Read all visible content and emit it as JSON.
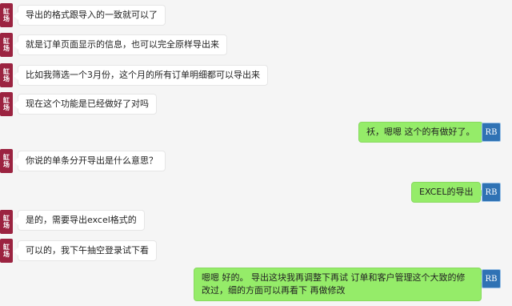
{
  "left_avatar_text": "缸\n场",
  "right_avatar_text": "RB",
  "messages": [
    {
      "side": "left",
      "text": "导出的格式跟导入的一致就可以了"
    },
    {
      "side": "left",
      "text": "就是订单页面显示的信息，也可以完全原样导出来"
    },
    {
      "side": "left",
      "text": "比如我筛选一个3月份，这个月的所有订单明细都可以导出来"
    },
    {
      "side": "left",
      "text": "现在这个功能是已经做好了对吗"
    },
    {
      "side": "right",
      "text": "袄，嗯嗯 这个的有做好了。"
    },
    {
      "side": "left",
      "text": "你说的单条分开导出是什么意思？"
    },
    {
      "side": "right",
      "text": "EXCEL的导出"
    },
    {
      "side": "left",
      "text": "是的，需要导出excel格式的"
    },
    {
      "side": "left",
      "text": "可以的，我下午抽空登录试下看"
    },
    {
      "side": "right",
      "text": "嗯嗯 好的。 导出这块我再调整下再试 订单和客户管理这个大致的修改过，细的方面可以再看下 再做修改"
    }
  ],
  "colors": {
    "incoming": "#ffffff",
    "outgoing": "#95ec69",
    "left_avatar": "#9b2340",
    "right_avatar": "#2f72b4"
  }
}
